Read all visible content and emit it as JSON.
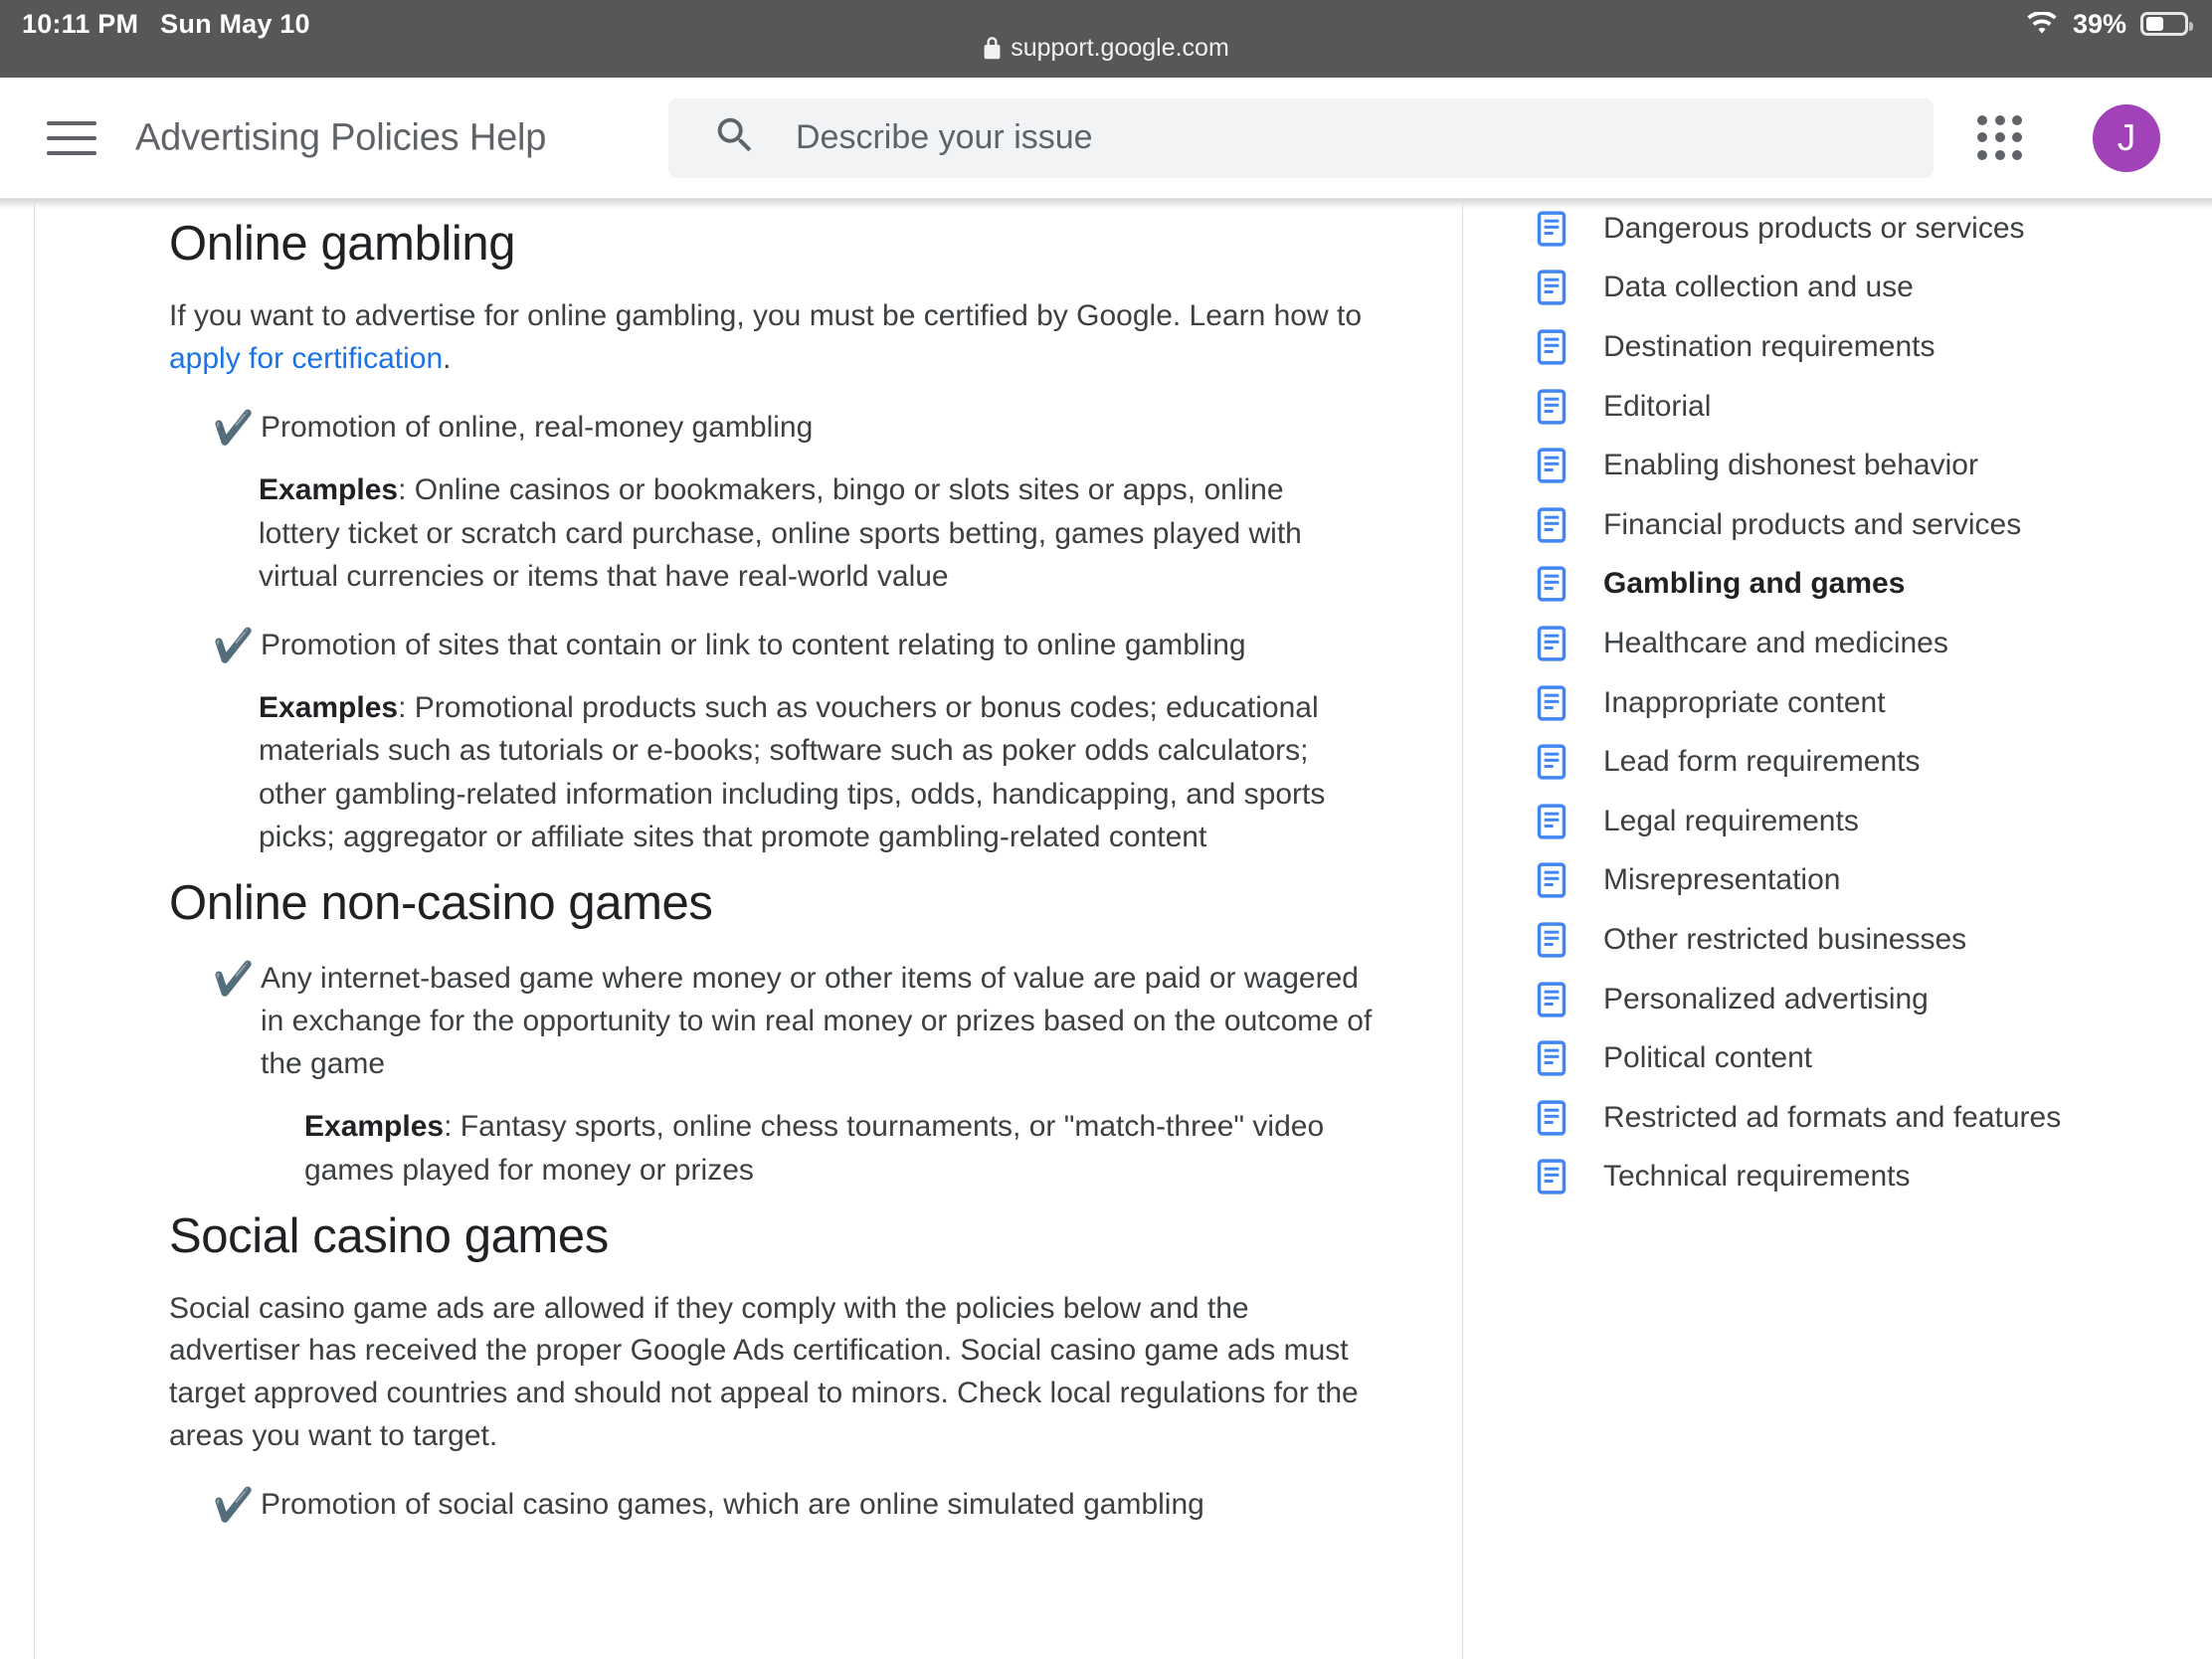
{
  "statusbar": {
    "time": "10:11 PM",
    "date": "Sun May 10",
    "battery_percent": "39%",
    "url": "support.google.com",
    "wifi_icon": "wifi-icon",
    "lock_icon": "lock-icon",
    "battery_icon": "battery-icon"
  },
  "header": {
    "menu_icon": "hamburger-menu-icon",
    "title": "Advertising Policies Help",
    "search_icon": "search-icon",
    "search_value": "",
    "search_placeholder": "Describe your issue",
    "apps_icon": "apps-grid-icon",
    "avatar_initial": "J"
  },
  "article": {
    "sections": [
      {
        "heading": "Online gambling",
        "intro_before": "If you want to advertise for online gambling, you must be certified by Google. Learn how to ",
        "intro_link": "apply for certification",
        "intro_after": ".",
        "bullets": [
          {
            "check_icon": "check-mark-icon",
            "text": "Promotion of online, real-money gambling",
            "examples_label": "Examples",
            "examples_text": ": Online casinos or bookmakers, bingo or slots sites or apps, online lottery ticket or scratch card purchase, online sports betting, games played with virtual currencies or items that have real-world value"
          },
          {
            "check_icon": "check-mark-icon",
            "text": "Promotion of sites that contain or link to content relating to online gambling",
            "examples_label": "Examples",
            "examples_text": ": Promotional products such as vouchers or bonus codes; educational materials such as tutorials or e-books; software such as poker odds calculators; other gambling-related information including tips, odds, handicapping, and sports picks; aggregator or affiliate sites that promote gambling-related content"
          }
        ]
      },
      {
        "heading": "Online non-casino games",
        "bullets": [
          {
            "check_icon": "check-mark-icon",
            "text": "Any internet-based game where money or other items of value are paid or wagered in exchange for the opportunity to win real money or prizes based on the outcome of the game",
            "examples_label": "Examples",
            "examples_text": ": Fantasy sports, online chess tournaments, or \"match-three\" video games played for money or prizes"
          }
        ]
      },
      {
        "heading": "Social casino games",
        "intro_before": "Social casino game ads are allowed if they comply with the policies below and the advertiser has received the proper Google Ads certification. Social casino game ads must target approved countries and should not appeal to minors. Check local regulations for the areas you want to target.",
        "bullets": [
          {
            "check_icon": "check-mark-icon",
            "text": "Promotion of social casino games, which are online simulated gambling"
          }
        ]
      }
    ]
  },
  "sidebar": {
    "items": [
      {
        "label": "Dangerous products or services",
        "icon": "document-icon",
        "current": false
      },
      {
        "label": "Data collection and use",
        "icon": "document-icon",
        "current": false
      },
      {
        "label": "Destination requirements",
        "icon": "document-icon",
        "current": false
      },
      {
        "label": "Editorial",
        "icon": "document-icon",
        "current": false
      },
      {
        "label": "Enabling dishonest behavior",
        "icon": "document-icon",
        "current": false
      },
      {
        "label": "Financial products and services",
        "icon": "document-icon",
        "current": false
      },
      {
        "label": "Gambling and games",
        "icon": "document-icon",
        "current": true
      },
      {
        "label": "Healthcare and medicines",
        "icon": "document-icon",
        "current": false
      },
      {
        "label": "Inappropriate content",
        "icon": "document-icon",
        "current": false
      },
      {
        "label": "Lead form requirements",
        "icon": "document-icon",
        "current": false
      },
      {
        "label": "Legal requirements",
        "icon": "document-icon",
        "current": false
      },
      {
        "label": "Misrepresentation",
        "icon": "document-icon",
        "current": false
      },
      {
        "label": "Other restricted businesses",
        "icon": "document-icon",
        "current": false
      },
      {
        "label": "Personalized advertising",
        "icon": "document-icon",
        "current": false
      },
      {
        "label": "Political content",
        "icon": "document-icon",
        "current": false
      },
      {
        "label": "Restricted ad formats and features",
        "icon": "document-icon",
        "current": false
      },
      {
        "label": "Technical requirements",
        "icon": "document-icon",
        "current": false
      }
    ]
  },
  "colors": {
    "statusbar_bg": "#575757",
    "link": "#1a73e8",
    "avatar_bg": "#a142b8",
    "sidebar_icon": "#4285f4",
    "text": "#3c4043"
  }
}
